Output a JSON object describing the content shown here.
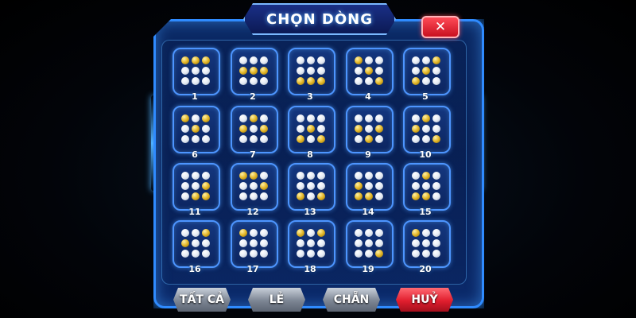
{
  "dialog": {
    "title": "CHỌN DÒNG",
    "close_label": "✕"
  },
  "colors": {
    "panel_border": "#2f8bff",
    "tile_border": "#4d95ff",
    "gold_dot": "#e3b627",
    "white_dot": "#e6ecf5",
    "cancel_button": "#e11e2e",
    "secondary_button": "#7c8593"
  },
  "lines": [
    {
      "label": "1",
      "pattern": [
        "g",
        "g",
        "g",
        "w",
        "w",
        "w",
        "w",
        "w",
        "w"
      ]
    },
    {
      "label": "2",
      "pattern": [
        "w",
        "w",
        "w",
        "g",
        "g",
        "g",
        "w",
        "w",
        "w"
      ]
    },
    {
      "label": "3",
      "pattern": [
        "w",
        "w",
        "w",
        "w",
        "w",
        "w",
        "g",
        "g",
        "g"
      ]
    },
    {
      "label": "4",
      "pattern": [
        "g",
        "w",
        "w",
        "w",
        "g",
        "w",
        "w",
        "w",
        "g"
      ]
    },
    {
      "label": "5",
      "pattern": [
        "w",
        "w",
        "g",
        "w",
        "g",
        "w",
        "g",
        "w",
        "w"
      ]
    },
    {
      "label": "6",
      "pattern": [
        "g",
        "w",
        "g",
        "w",
        "g",
        "w",
        "w",
        "w",
        "w"
      ]
    },
    {
      "label": "7",
      "pattern": [
        "w",
        "g",
        "w",
        "g",
        "w",
        "g",
        "w",
        "w",
        "w"
      ]
    },
    {
      "label": "8",
      "pattern": [
        "w",
        "w",
        "w",
        "w",
        "g",
        "w",
        "g",
        "w",
        "g"
      ]
    },
    {
      "label": "9",
      "pattern": [
        "w",
        "w",
        "w",
        "g",
        "w",
        "g",
        "w",
        "g",
        "w"
      ]
    },
    {
      "label": "10",
      "pattern": [
        "w",
        "g",
        "w",
        "g",
        "w",
        "w",
        "w",
        "w",
        "g"
      ]
    },
    {
      "label": "11",
      "pattern": [
        "w",
        "w",
        "w",
        "w",
        "w",
        "g",
        "w",
        "g",
        "g"
      ]
    },
    {
      "label": "12",
      "pattern": [
        "g",
        "g",
        "w",
        "w",
        "w",
        "g",
        "w",
        "w",
        "w"
      ]
    },
    {
      "label": "13",
      "pattern": [
        "w",
        "w",
        "w",
        "w",
        "w",
        "w",
        "g",
        "w",
        "g"
      ]
    },
    {
      "label": "14",
      "pattern": [
        "w",
        "w",
        "w",
        "g",
        "w",
        "w",
        "g",
        "g",
        "w"
      ]
    },
    {
      "label": "15",
      "pattern": [
        "w",
        "g",
        "w",
        "w",
        "w",
        "w",
        "g",
        "g",
        "w"
      ]
    },
    {
      "label": "16",
      "pattern": [
        "w",
        "w",
        "g",
        "g",
        "w",
        "w",
        "w",
        "w",
        "w"
      ]
    },
    {
      "label": "17",
      "pattern": [
        "g",
        "w",
        "w",
        "w",
        "w",
        "w",
        "w",
        "w",
        "w"
      ]
    },
    {
      "label": "18",
      "pattern": [
        "g",
        "w",
        "g",
        "w",
        "w",
        "w",
        "w",
        "w",
        "w"
      ]
    },
    {
      "label": "19",
      "pattern": [
        "w",
        "w",
        "w",
        "w",
        "w",
        "w",
        "w",
        "w",
        "g"
      ]
    },
    {
      "label": "20",
      "pattern": [
        "g",
        "w",
        "w",
        "w",
        "w",
        "w",
        "w",
        "w",
        "w"
      ]
    }
  ],
  "buttons": {
    "select_all": "TẤT CẢ",
    "odd": "LẺ",
    "even": "CHẴN",
    "cancel": "HUỶ"
  }
}
